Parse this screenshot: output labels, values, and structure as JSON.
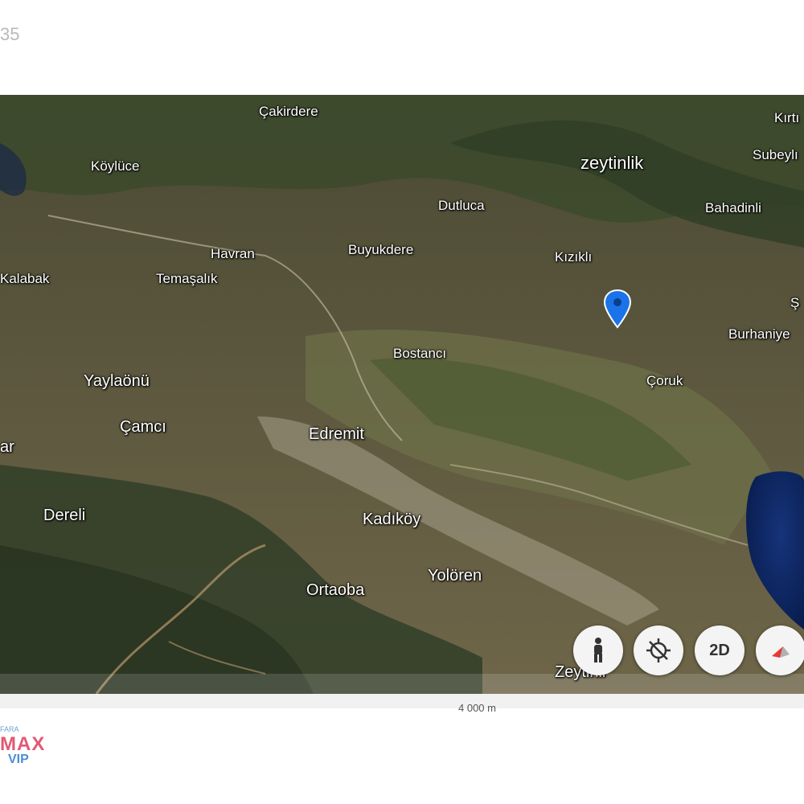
{
  "header": {
    "counter_text": "35"
  },
  "map": {
    "places": {
      "cakirdere": "Çakirdere",
      "kirti": "Kırtı",
      "koyluce": "Köylüce",
      "zeytinlik": "zeytinlik",
      "subeyli": "Subeylı",
      "dutluca": "Dutluca",
      "bahadinli": "Bahadinli",
      "havran": "Havran",
      "buyukdere": "Buyukdere",
      "kizikli": "Kızıklı",
      "kalabak": "Kalabak",
      "temasalik": "Temaşalık",
      "burhaniye": "Burhaniye",
      "bostanci": "Bostancı",
      "yaylaonu": "Yaylaönü",
      "coruk": "Çoruk",
      "camci": "Çamcı",
      "edremit": "Edremit",
      "ar_partial": "ar",
      "dereli": "Dereli",
      "kadikoy": "Kadıköy",
      "yoloren": "Yolören",
      "ortaoba": "Ortaoba",
      "zeytinli": "Zeytinli",
      "s_partial": "Ş"
    },
    "marker_icon": "location-pin-icon",
    "controls": {
      "pegman_icon": "pegman-icon",
      "compass_icon": "compass-icon",
      "view_2d_label": "2D",
      "orientation_icon": "north-arrow-icon"
    },
    "scale_label": "4 000 m",
    "colors": {
      "marker": "#1a73e8",
      "sea": "#0d2a66",
      "label": "#ffffff"
    }
  },
  "logo": {
    "tagline": "FARA",
    "brand": "MAX",
    "sub": "VIP"
  }
}
